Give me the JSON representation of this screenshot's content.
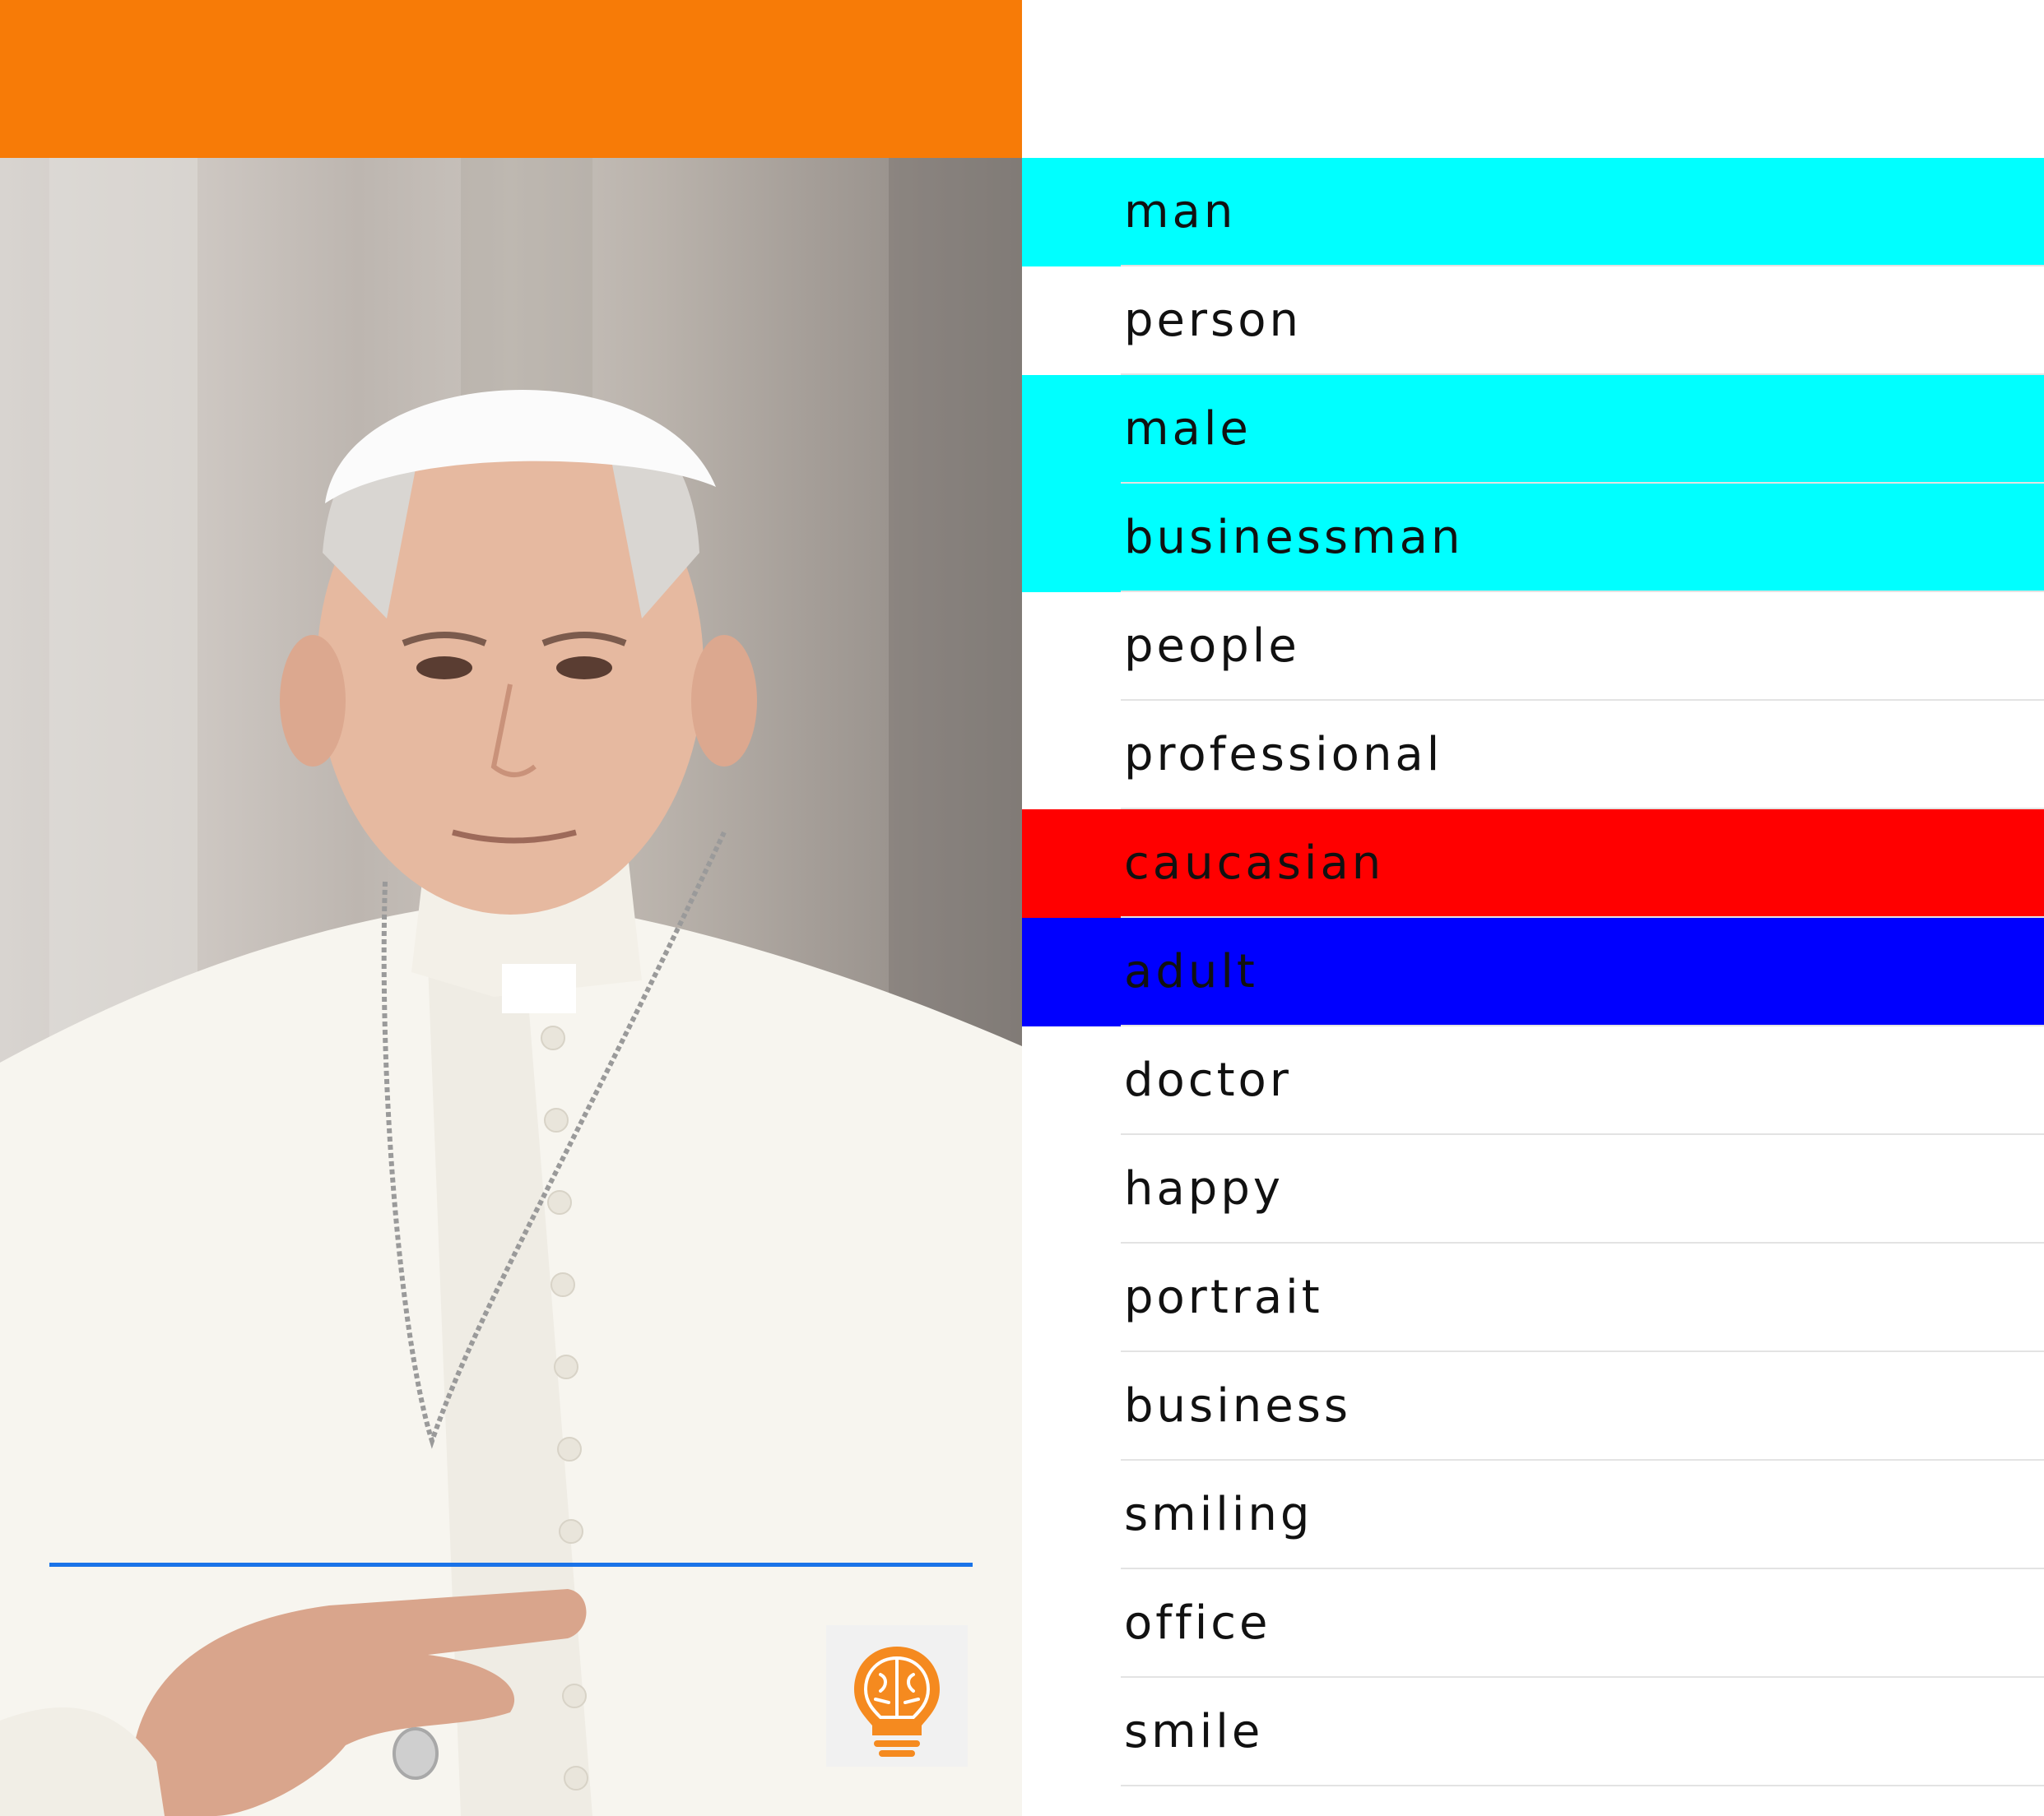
{
  "header": {
    "bar_color": "#f77b07"
  },
  "photo": {
    "subject": "portrait-photo"
  },
  "progress": {
    "color": "#1a73e8"
  },
  "app_icon": {
    "icon": "lightbulb-brain-icon",
    "accent": "#f58a1f",
    "background": "#f1f1f1"
  },
  "tags": [
    {
      "label": "man",
      "highlight": "#00ffff"
    },
    {
      "label": "person",
      "highlight": "#ffffff"
    },
    {
      "label": "male",
      "highlight": "#00ffff"
    },
    {
      "label": "businessman",
      "highlight": "#00ffff"
    },
    {
      "label": "people",
      "highlight": "#ffffff"
    },
    {
      "label": "professional",
      "highlight": "#ffffff"
    },
    {
      "label": "caucasian",
      "highlight": "#ff0000"
    },
    {
      "label": "adult",
      "highlight": "#0000ff"
    },
    {
      "label": "doctor",
      "highlight": "#ffffff"
    },
    {
      "label": "happy",
      "highlight": "#ffffff"
    },
    {
      "label": "portrait",
      "highlight": "#ffffff"
    },
    {
      "label": "business",
      "highlight": "#ffffff"
    },
    {
      "label": "smiling",
      "highlight": "#ffffff"
    },
    {
      "label": "office",
      "highlight": "#ffffff"
    },
    {
      "label": "smile",
      "highlight": "#ffffff"
    }
  ]
}
